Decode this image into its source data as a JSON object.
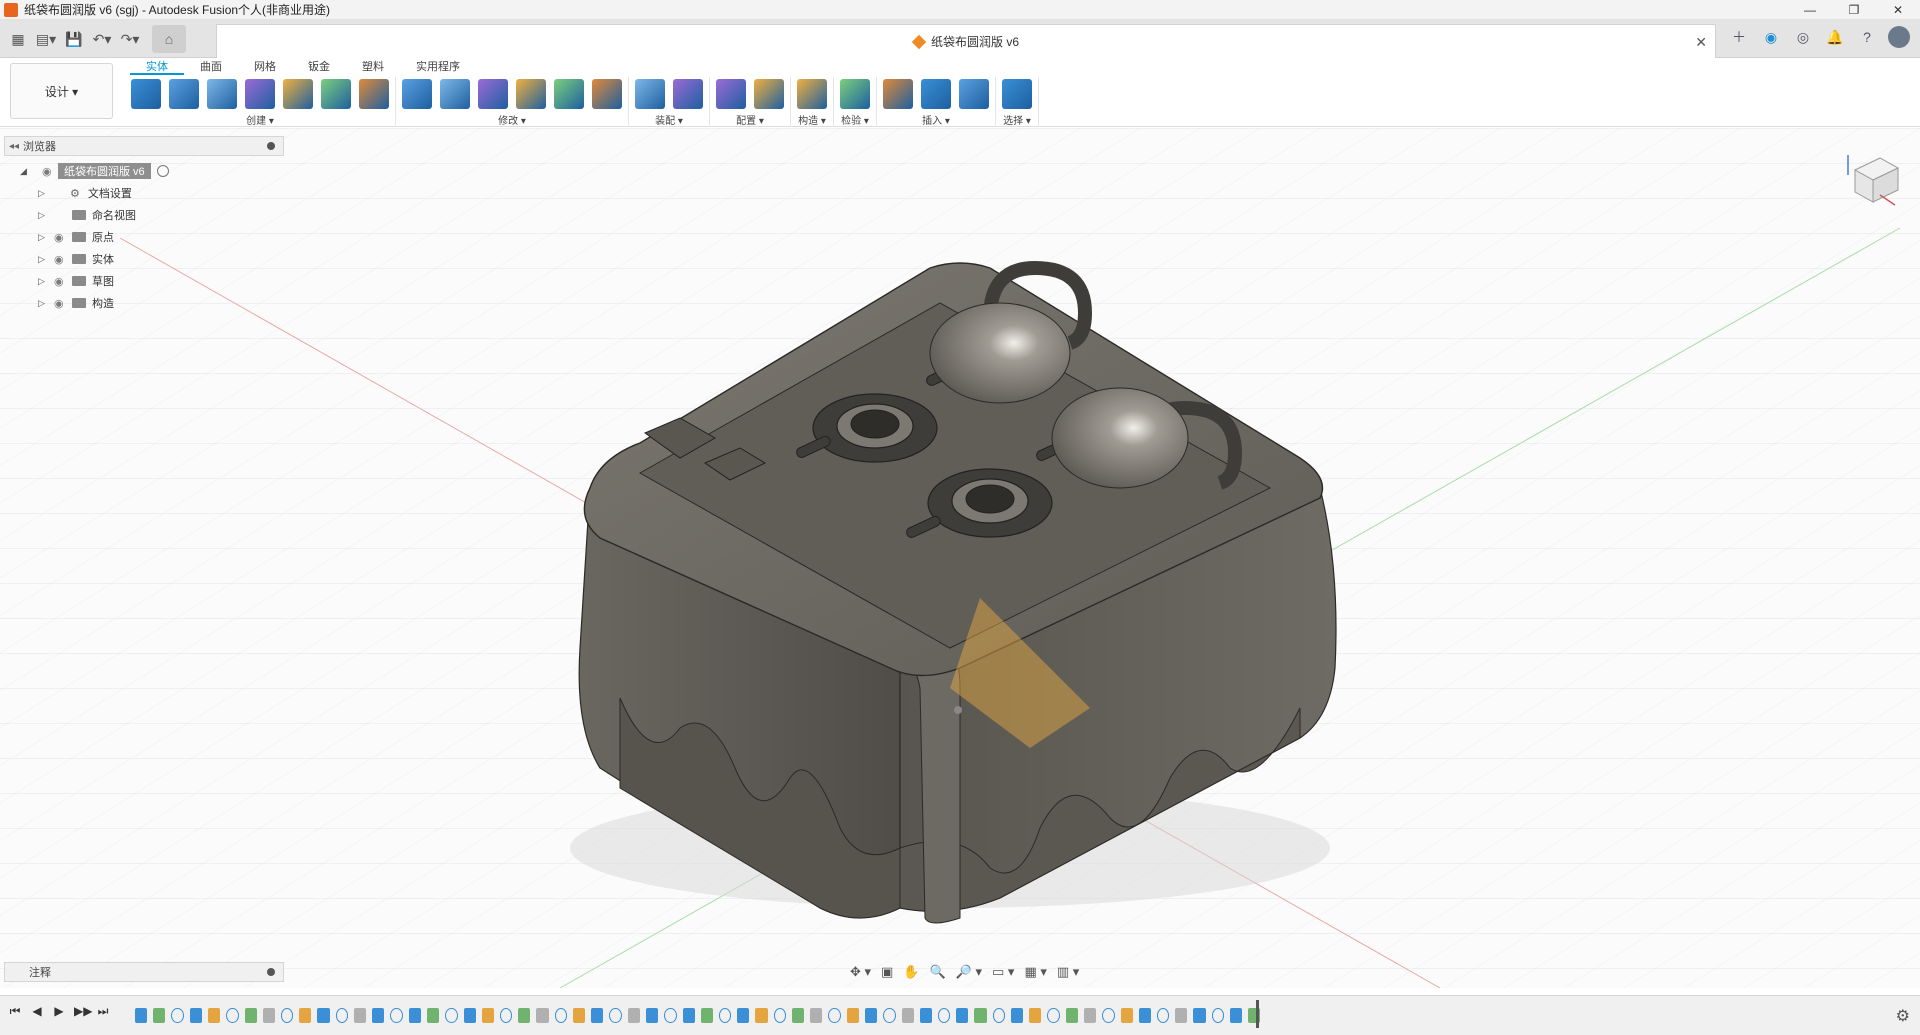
{
  "window": {
    "title": "纸袋布圆润版 v6 (sgj) - Autodesk Fusion个人(非商业用途)",
    "minimize": "—",
    "restore": "❐",
    "close": "✕"
  },
  "document_tab": {
    "title": "纸袋布圆润版 v6",
    "close": "✕"
  },
  "workspace": {
    "label": "设计 ▾"
  },
  "ribbon_tabs": [
    {
      "label": "实体",
      "active": true
    },
    {
      "label": "曲面"
    },
    {
      "label": "网格"
    },
    {
      "label": "钣金"
    },
    {
      "label": "塑料"
    },
    {
      "label": "实用程序"
    }
  ],
  "ribbon_groups": [
    {
      "label": "创建 ▾",
      "icons": [
        "sketch-icon",
        "extrude-icon",
        "revolve-icon",
        "hole-icon",
        "pattern-icon",
        "form-icon",
        "surface-icon"
      ]
    },
    {
      "label": "修改 ▾",
      "icons": [
        "press-pull-icon",
        "fillet-icon",
        "shell-icon",
        "combine-icon",
        "split-icon",
        "move-icon"
      ]
    },
    {
      "label": "装配 ▾",
      "icons": [
        "new-component-icon",
        "joint-icon"
      ]
    },
    {
      "label": "配置 ▾",
      "icons": [
        "config-icon",
        "table-icon"
      ]
    },
    {
      "label": "构造 ▾",
      "icons": [
        "plane-icon"
      ]
    },
    {
      "label": "检验 ▾",
      "icons": [
        "measure-icon"
      ]
    },
    {
      "label": "插入 ▾",
      "icons": [
        "insert-link-icon",
        "insert-component-icon",
        "insert-image-icon"
      ]
    },
    {
      "label": "选择 ▾",
      "icons": [
        "select-icon"
      ]
    }
  ],
  "colors": {
    "accent": "#0696d7",
    "model": "#6b6862",
    "model_dark": "#4a4843",
    "model_light": "#8a877f",
    "grid": "#e4e6ea",
    "axis_red": "#e88e8e",
    "axis_green": "#9ed39e"
  },
  "browser": {
    "label": "浏览器",
    "root": "纸袋布圆润版 v6",
    "items": [
      {
        "label": "文档设置",
        "icon": "gear-icon"
      },
      {
        "label": "命名视图",
        "icon": "folder-icon"
      },
      {
        "label": "原点",
        "icon": "folder-icon",
        "eye": true
      },
      {
        "label": "实体",
        "icon": "folder-icon",
        "eye": true
      },
      {
        "label": "草图",
        "icon": "folder-icon",
        "eye": true
      },
      {
        "label": "构造",
        "icon": "folder-icon",
        "eye": true
      }
    ]
  },
  "notes": {
    "label": "注释"
  },
  "navbar": {
    "items": [
      "✥ ▾",
      "▣",
      "✋",
      "🔍",
      "🔎 ▾",
      "▭ ▾",
      "▦ ▾",
      "▥ ▾"
    ]
  },
  "timeline": {
    "controls": [
      "⏮",
      "◀",
      "▶",
      "▶▶",
      "⏭"
    ],
    "feature_colors": [
      "#3a8fd6",
      "#6fb36f",
      "#b0b0b0",
      "#3a8fd6",
      "#e4a43f"
    ],
    "feature_count": 62
  }
}
